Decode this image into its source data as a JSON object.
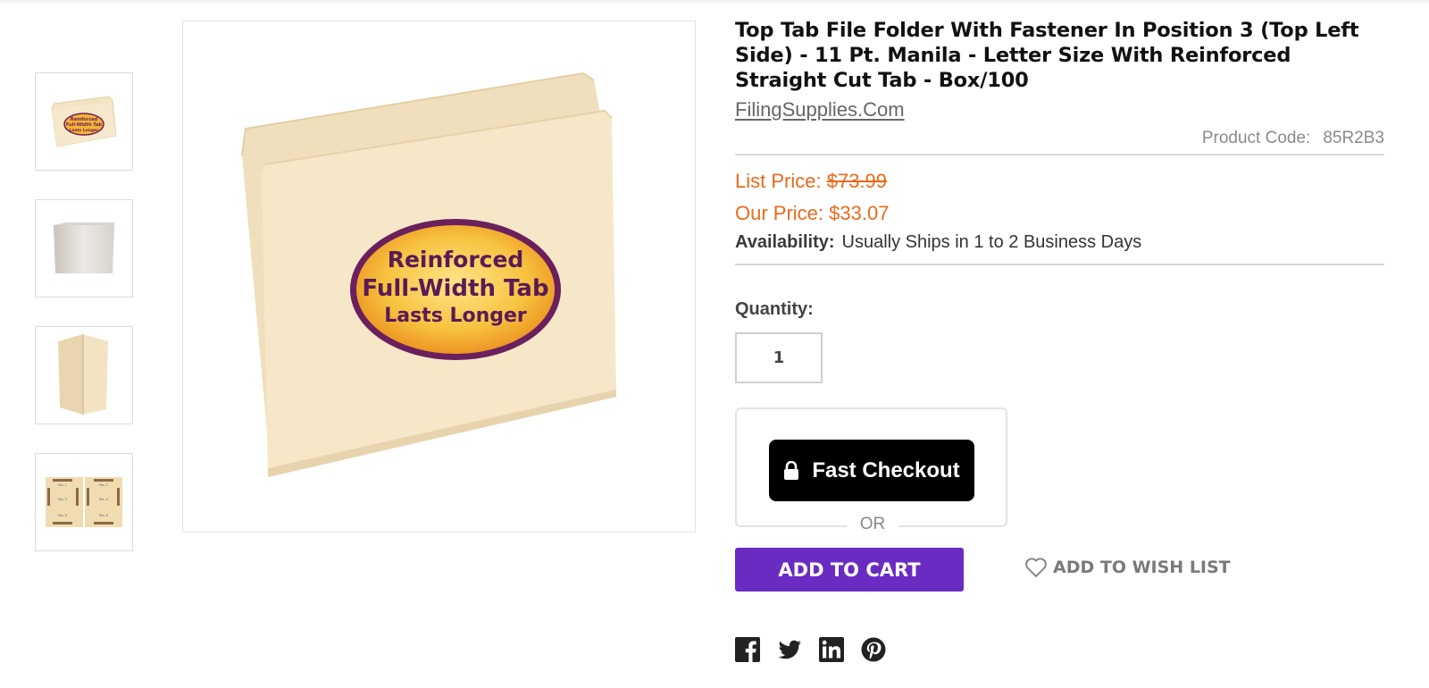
{
  "product": {
    "title": "Top Tab File Folder With Fastener In Position 3 (Top Left Side) - 11 Pt. Manila - Letter Size With Reinforced Straight Cut Tab - Box/100",
    "brand": "FilingSupplies.Com",
    "code_label": "Product Code:",
    "code_value": "85R2B3",
    "list_price_label": "List Price:",
    "list_price": "$73.99",
    "our_price_label": "Our Price:",
    "our_price": "$33.07",
    "availability_label": "Availability:",
    "availability_value": "Usually Ships in 1 to 2 Business Days"
  },
  "image": {
    "badge_lines": [
      "Reinforced",
      "Full-Width Tab",
      "Lasts Longer"
    ],
    "thumb_badge_lines": [
      "Reinforced",
      "Full-Width Tab",
      "Lasts Longer"
    ],
    "thumb_labels": [
      "Pos. 1",
      "Pos. 2",
      "Pos. 3",
      "Pos. 4",
      "Pos. 5",
      "Pos. 6"
    ]
  },
  "purchase": {
    "quantity_label": "Quantity:",
    "quantity_value": "1",
    "fast_checkout_label": "Fast Checkout",
    "or_label": "OR",
    "add_to_cart_label": "ADD TO CART",
    "wishlist_label": "ADD TO WISH LIST"
  },
  "social": {
    "icons": [
      "facebook-icon",
      "twitter-icon",
      "linkedin-icon",
      "pinterest-icon"
    ]
  },
  "colors": {
    "price_orange": "#ea6a1a",
    "cart_purple": "#6a2bc2",
    "checkout_black": "#000000",
    "manila": "#f5e6c8",
    "badge_purple": "#6b1f5c",
    "badge_gold": "#f5b335"
  }
}
